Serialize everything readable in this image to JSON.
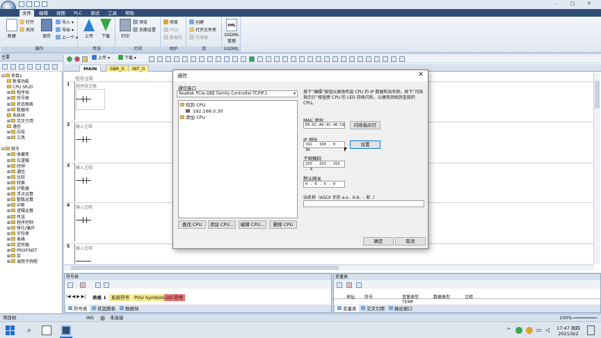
{
  "ribbon": {
    "tabs": [
      "文件",
      "编辑",
      "视图",
      "PLC",
      "调试",
      "工具",
      "帮助"
    ],
    "active_tab": "文件",
    "groups": {
      "operation": {
        "label": "操作",
        "new": "新建",
        "open": "打开",
        "close": "关闭",
        "save": "保存",
        "import": "导入 ▾",
        "export": "导出 ▾",
        "previous": "上一个 ▾"
      },
      "transfer": {
        "label": "传送",
        "upload": "上传",
        "download": "下载"
      },
      "print": {
        "label": "打印",
        "print": "打印",
        "preview": "预览",
        "page_setup": "页面设置"
      },
      "protect": {
        "label": "保护",
        "project": "项目",
        "pou": "POU",
        "data_page": "数据页"
      },
      "library": {
        "label": "库",
        "create": "创建",
        "open_folder": "打开文件夹",
        "memory": "存储器"
      },
      "gsdml": {
        "label": "GSDML",
        "manage": "GSDML 管理"
      }
    }
  },
  "tree": {
    "header": "主要",
    "items": [
      {
        "label": "项目1",
        "level": 0,
        "exp": "⊟"
      },
      {
        "label": "新增功能",
        "level": 1,
        "exp": ""
      },
      {
        "label": "CPU SR20",
        "level": 1,
        "exp": ""
      },
      {
        "label": "程序块",
        "level": 1,
        "exp": "⊞"
      },
      {
        "label": "符号表",
        "level": 1,
        "exp": "⊞"
      },
      {
        "label": "状态图表",
        "level": 1,
        "exp": "⊞"
      },
      {
        "label": "数据块",
        "level": 1,
        "exp": "⊞"
      },
      {
        "label": "系统块",
        "level": 1,
        "exp": ""
      },
      {
        "label": "交叉引用",
        "level": 1,
        "exp": "⊞"
      },
      {
        "label": "通信",
        "level": 1,
        "exp": ""
      },
      {
        "label": "向导",
        "level": 1,
        "exp": "⊞"
      },
      {
        "label": "工具",
        "level": 1,
        "exp": "⊞"
      },
      {
        "label": "",
        "level": 0,
        "exp": ""
      },
      {
        "label": "指令",
        "level": 0,
        "exp": "⊟"
      },
      {
        "label": "收藏夹",
        "level": 1,
        "exp": "⊞"
      },
      {
        "label": "位逻辑",
        "level": 1,
        "exp": "⊞"
      },
      {
        "label": "时钟",
        "level": 1,
        "exp": "⊞"
      },
      {
        "label": "通信",
        "level": 1,
        "exp": "⊞"
      },
      {
        "label": "比较",
        "level": 1,
        "exp": "⊞"
      },
      {
        "label": "转换",
        "level": 1,
        "exp": "⊞"
      },
      {
        "label": "计数器",
        "level": 1,
        "exp": "⊞"
      },
      {
        "label": "浮点运算",
        "level": 1,
        "exp": "⊞"
      },
      {
        "label": "整数运算",
        "level": 1,
        "exp": "⊞"
      },
      {
        "label": "中断",
        "level": 1,
        "exp": "⊞"
      },
      {
        "label": "逻辑运算",
        "level": 1,
        "exp": "⊞"
      },
      {
        "label": "传送",
        "level": 1,
        "exp": "⊞"
      },
      {
        "label": "程序控制",
        "level": 1,
        "exp": "⊞"
      },
      {
        "label": "移位/循环",
        "level": 1,
        "exp": "⊞"
      },
      {
        "label": "字符串",
        "level": 1,
        "exp": "⊞"
      },
      {
        "label": "表格",
        "level": 1,
        "exp": "⊞"
      },
      {
        "label": "定时器",
        "level": 1,
        "exp": "⊞"
      },
      {
        "label": "PROFINET",
        "level": 1,
        "exp": "⊞"
      },
      {
        "label": "库",
        "level": 1,
        "exp": "⊞"
      },
      {
        "label": "调用子例程",
        "level": 1,
        "exp": "⊞"
      }
    ]
  },
  "editor": {
    "toolbar_upload": "上传",
    "toolbar_download": "下载",
    "tabs": [
      "MAIN",
      "SBR_0",
      "INT_0"
    ],
    "program_comment": "程序注释",
    "networks": [
      {
        "num": "1",
        "comment": "程序段注释"
      },
      {
        "num": "2",
        "comment": "输入注释"
      },
      {
        "num": "3",
        "comment": "输入注释"
      },
      {
        "num": "4",
        "comment": "输入注释"
      },
      {
        "num": "5",
        "comment": "输入注释"
      }
    ]
  },
  "dialog": {
    "title": "通信",
    "interface_label": "通信接口",
    "interface_value": "Realtek PCIe GBE Family Controller.TCPIP.1",
    "instructions": "按下“编辑”按钮以更改所选 CPU 的 IP 数据和站名称。按下“闪烁指示灯”按钮使 CPU 的 LED 持续闪烁，以便目测找到连接的 CPU。",
    "tree": {
      "found": "找到 CPU",
      "ip": "192.168.0.30",
      "add": "添加 CPU"
    },
    "mac_label": "MAC 地址",
    "mac_value": "E0:DC:A0:4C:40:C8",
    "blink_button": "闪烁指示灯",
    "ip_label": "IP 地址",
    "ip_value": "192 . 168 .  0  . 30",
    "set_button": "设置",
    "subnet_label": "子网掩码",
    "subnet_value": "255 . 255 . 255 .  0",
    "gateway_label": "默认网关",
    "gateway_value": " 0  .  0  .  0  .  0",
    "station_label": "站名称（ASCII 字符 a-z、0-9、- 和 .）",
    "station_value": "",
    "find_cpu": "查找 CPU",
    "add_cpu": "添加 CPU...",
    "edit_cpu": "编辑 CPU...",
    "delete_cpu": "删除 CPU",
    "ok": "确定",
    "cancel": "取消"
  },
  "symbol_panel": {
    "title": "符号表",
    "subtabs": [
      "表格 1",
      "系统符号",
      "POU Symbols",
      "I/O 符号"
    ],
    "bottom_tabs": [
      "符号表",
      "状态图表",
      "数据块"
    ]
  },
  "var_panel": {
    "title": "变量表",
    "columns": [
      "地址",
      "符号",
      "变量类型",
      "数据类型",
      "注释"
    ],
    "first_row_type": "TEMP",
    "bottom_tabs": [
      "变量表",
      "交叉引用",
      "输出窗口"
    ]
  },
  "statusbar": {
    "left": "项目树",
    "ins": "INS",
    "connection": "未连接",
    "zoom": "100%"
  },
  "taskbar": {
    "time": "17:47 周四",
    "date": "2021/9/2"
  },
  "colors": {
    "ribbon_blue": "#2f4d76",
    "sub_tab_yellow": "#f4e98c",
    "io_tab_red": "#e57373"
  }
}
